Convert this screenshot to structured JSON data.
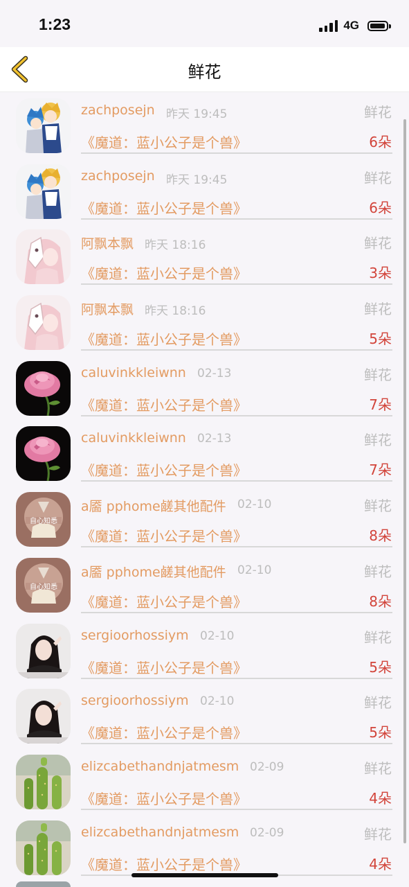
{
  "status_bar": {
    "time": "1:23",
    "network": "4G"
  },
  "nav": {
    "title": "鲜花",
    "back_icon": "chevron-left-icon"
  },
  "accent_colors": {
    "name": "#e39b62",
    "count": "#d2443a",
    "muted": "#bdbdbd"
  },
  "items": [
    {
      "user": "zachposejn",
      "time": "昨天 19:45",
      "type_label": "鲜花",
      "book": "《魔道：蓝小公子是个兽》",
      "count": "6朵",
      "avatar": "anime-couple"
    },
    {
      "user": "zachposejn",
      "time": "昨天 19:45",
      "type_label": "鲜花",
      "book": "《魔道：蓝小公子是个兽》",
      "count": "6朵",
      "avatar": "anime-couple"
    },
    {
      "user": "阿飘本飘",
      "time": "昨天 18:16",
      "type_label": "鲜花",
      "book": "《魔道：蓝小公子是个兽》",
      "count": "3朵",
      "avatar": "anime-mask-girl"
    },
    {
      "user": "阿飘本飘",
      "time": "昨天 18:16",
      "type_label": "鲜花",
      "book": "《魔道：蓝小公子是个兽》",
      "count": "5朵",
      "avatar": "anime-mask-girl"
    },
    {
      "user": "caluvinkkleiwnn",
      "time": "02-13",
      "type_label": "鲜花",
      "book": "《魔道：蓝小公子是个兽》",
      "count": "7朵",
      "avatar": "pink-rose"
    },
    {
      "user": "caluvinkkleiwnn",
      "time": "02-13",
      "type_label": "鲜花",
      "book": "《魔道：蓝小公子是个兽》",
      "count": "7朵",
      "avatar": "pink-rose"
    },
    {
      "user": "a靥 pphome鹾其他配件",
      "time": "02-10",
      "type_label": "鲜花",
      "book": "《魔道：蓝小公子是个兽》",
      "count": "8朵",
      "avatar": "hourglass"
    },
    {
      "user": "a靥 pphome鹾其他配件",
      "time": "02-10",
      "type_label": "鲜花",
      "book": "《魔道：蓝小公子是个兽》",
      "count": "8朵",
      "avatar": "hourglass"
    },
    {
      "user": "sergioorhossiym",
      "time": "02-10",
      "type_label": "鲜花",
      "book": "《魔道：蓝小公子是个兽》",
      "count": "5朵",
      "avatar": "girl-photo"
    },
    {
      "user": "sergioorhossiym",
      "time": "02-10",
      "type_label": "鲜花",
      "book": "《魔道：蓝小公子是个兽》",
      "count": "5朵",
      "avatar": "girl-photo"
    },
    {
      "user": "elizcabethandnjatmesm",
      "time": "02-09",
      "type_label": "鲜花",
      "book": "《魔道：蓝小公子是个兽》",
      "count": "4朵",
      "avatar": "cactus"
    },
    {
      "user": "elizcabethandnjatmesm",
      "time": "02-09",
      "type_label": "鲜花",
      "book": "《魔道：蓝小公子是个兽》",
      "count": "4朵",
      "avatar": "cactus"
    }
  ]
}
